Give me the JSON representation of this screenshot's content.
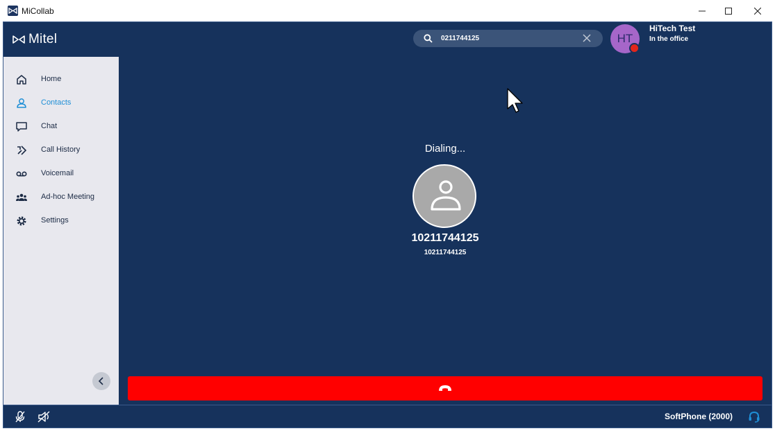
{
  "window": {
    "title": "MiCollab",
    "controls": [
      "minimize-icon",
      "maximize-icon",
      "close-icon"
    ]
  },
  "header": {
    "logo_text": "Mitel",
    "search": {
      "value": "0211744125",
      "icon": "search-icon",
      "clear_icon": "close-icon"
    },
    "user": {
      "initials": "HT",
      "name": "HiTech Test",
      "status": "In the office",
      "presence_color": "#e2261c"
    }
  },
  "sidebar": {
    "items": [
      {
        "label": "Home",
        "icon": "home-icon",
        "active": false
      },
      {
        "label": "Contacts",
        "icon": "contacts-icon",
        "active": true
      },
      {
        "label": "Chat",
        "icon": "chat-icon",
        "active": false
      },
      {
        "label": "Call History",
        "icon": "call-history-icon",
        "active": false
      },
      {
        "label": "Voicemail",
        "icon": "voicemail-icon",
        "active": false
      },
      {
        "label": "Ad-hoc Meeting",
        "icon": "meeting-icon",
        "active": false
      },
      {
        "label": "Settings",
        "icon": "gear-icon",
        "active": false
      }
    ],
    "collapse_icon": "chevron-left-icon"
  },
  "call": {
    "status": "Dialing...",
    "contact_name": "10211744125",
    "contact_number": "10211744125",
    "hangup_icon": "hang-up-icon",
    "hangup_color": "#ff0000"
  },
  "statusbar": {
    "device": "SoftPhone (2000)",
    "mic_icon": "mic-muted-icon",
    "speaker_icon": "speaker-muted-icon",
    "phone_icon": "headset-status-icon"
  },
  "colors": {
    "background": "#16325c",
    "accent": "#1f8fd6",
    "sidebar": "#e8e8ee"
  }
}
